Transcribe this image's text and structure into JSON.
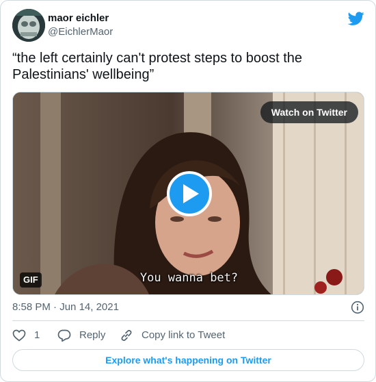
{
  "author": {
    "display_name": "maor eichler",
    "handle": "@EichlerMaor"
  },
  "tweet": {
    "text": "“the left certainly can't protest steps to boost the Palestinians' wellbeing”"
  },
  "media": {
    "watch_label": "Watch on Twitter",
    "gif_label": "GIF",
    "subtitle": "You wanna bet?"
  },
  "meta": {
    "time": "8:58 PM",
    "separator": "·",
    "date": "Jun 14, 2021"
  },
  "actions": {
    "like_count": "1",
    "reply_label": "Reply",
    "copy_label": "Copy link to Tweet"
  },
  "explore_label": "Explore what's happening on Twitter",
  "colors": {
    "accent": "#1d9bf0",
    "text_primary": "#0f1419",
    "text_secondary": "#536471",
    "border": "#cfd9de"
  },
  "icons": [
    "twitter-bird-icon",
    "play-icon",
    "info-icon",
    "heart-icon",
    "reply-icon",
    "link-icon"
  ]
}
